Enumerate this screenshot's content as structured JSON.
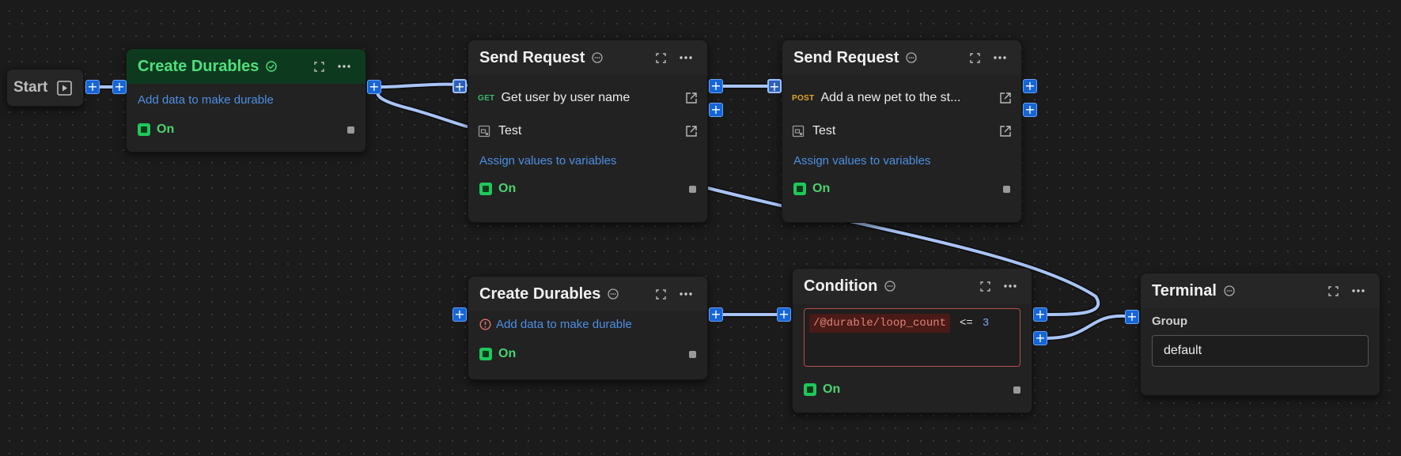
{
  "colors": {
    "canvas": "#1b1b1b",
    "node": "#222222",
    "accent": "#1565d8",
    "wire": "#a9c4f5",
    "success": "#1ec85a",
    "error": "#b8504a",
    "get": "#3fb86a",
    "post": "#e2a62a"
  },
  "start": {
    "label": "Start",
    "icon": "play-icon"
  },
  "create_durables_1": {
    "title": "Create Durables",
    "status_icon": "check-circle-icon",
    "link": "Add data to make durable",
    "toggle": "On"
  },
  "send_request_1": {
    "title": "Send Request",
    "status_icon": "ellipsis-circle-icon",
    "request": {
      "method": "GET",
      "name": "Get user by user name"
    },
    "test": {
      "name": "Test"
    },
    "link": "Assign values to variables",
    "toggle": "On"
  },
  "send_request_2": {
    "title": "Send Request",
    "status_icon": "ellipsis-circle-icon",
    "request": {
      "method": "POST",
      "name": "Add a new pet to the st..."
    },
    "test": {
      "name": "Test"
    },
    "link": "Assign values to variables",
    "toggle": "On"
  },
  "create_durables_2": {
    "title": "Create Durables",
    "status_icon": "ellipsis-circle-icon",
    "warning_icon": "alert-circle-icon",
    "link": "Add data to make durable",
    "toggle": "On"
  },
  "condition": {
    "title": "Condition",
    "status_icon": "ellipsis-circle-icon",
    "path": "/@durable/loop_count",
    "operator": "<=",
    "value": "3",
    "toggle": "On"
  },
  "terminal": {
    "title": "Terminal",
    "status_icon": "ellipsis-circle-icon",
    "group_label": "Group",
    "group_value": "default"
  },
  "port_symbol": "+"
}
